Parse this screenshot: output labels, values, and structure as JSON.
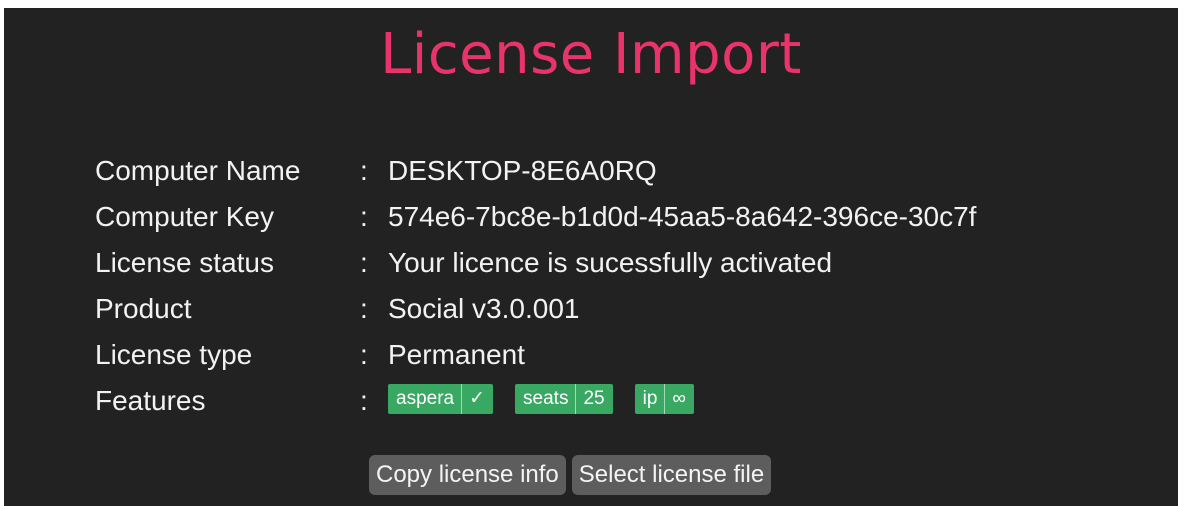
{
  "title": "License Import",
  "separator": ":",
  "info": [
    {
      "label": "Computer Name",
      "value": "DESKTOP-8E6A0RQ"
    },
    {
      "label": "Computer Key",
      "value": "574e6-7bc8e-b1d0d-45aa5-8a642-396ce-30c7f"
    },
    {
      "label": "License status",
      "value": "Your licence is sucessfully activated"
    },
    {
      "label": "Product",
      "value": "Social v3.0.001"
    },
    {
      "label": "License type",
      "value": "Permanent"
    }
  ],
  "features": {
    "label": "Features",
    "badges": [
      {
        "key": "aspera",
        "value": "✓"
      },
      {
        "key": "seats",
        "value": "25"
      },
      {
        "key": "ip",
        "value": "∞"
      }
    ]
  },
  "buttons": {
    "copy": "Copy license info",
    "select": "Select license file"
  },
  "colors": {
    "background": "#222222",
    "title": "#e8336b",
    "badge": "#39a863",
    "button": "#5d5d5d"
  }
}
